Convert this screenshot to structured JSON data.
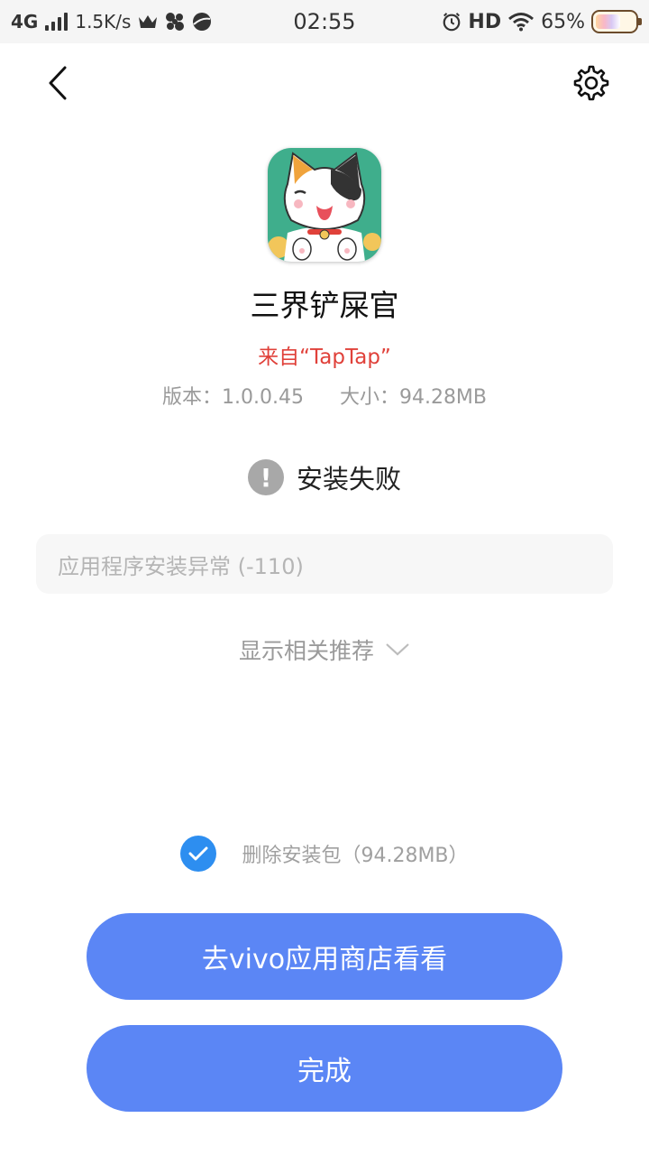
{
  "status_bar": {
    "network": "4G",
    "speed": "1.5K/s",
    "time": "02:55",
    "hd": "HD",
    "battery": "65%",
    "battery_level": 0.65
  },
  "app": {
    "name": "三界铲屎官",
    "source": "来自“TapTap”",
    "version": "版本：1.0.0.45",
    "size": "大小：94.28MB"
  },
  "install": {
    "status": "安装失败",
    "error": "应用程序安装异常 (-110)",
    "recommend_label": "显示相关推荐",
    "delete_label": "删除安装包（94.28MB）",
    "delete_checked": true
  },
  "buttons": {
    "store": "去vivo应用商店看看",
    "done": "完成"
  },
  "colors": {
    "accent": "#5b86f5",
    "check": "#2d8ef0",
    "source_red": "#e0413a"
  }
}
